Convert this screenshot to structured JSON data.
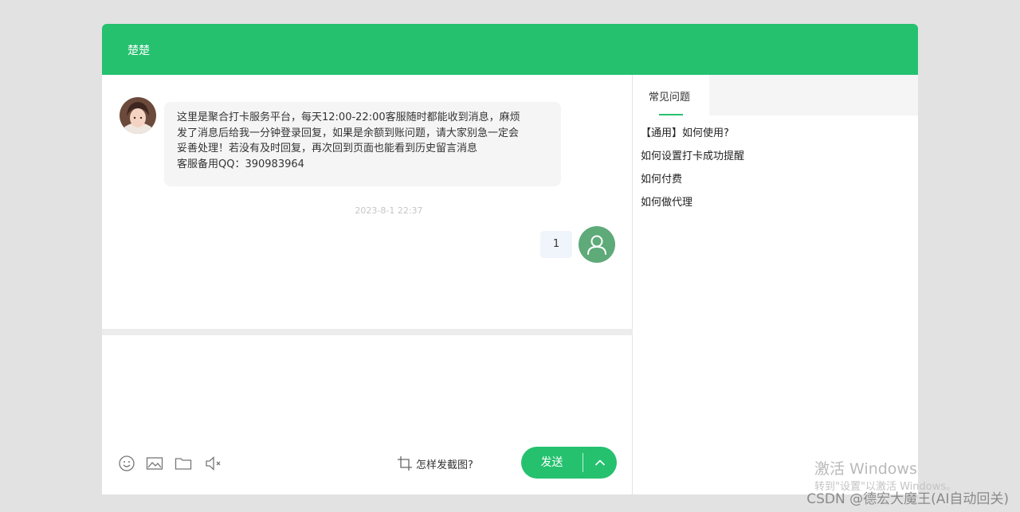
{
  "header": {
    "title": "楚楚"
  },
  "chat": {
    "welcome_lines": [
      "这里是聚合打卡服务平台，每天12:00-22:00客服随时都能收到消息，麻烦",
      "发了消息后给我一分钟登录回复，如果是余额到账问题，请大家别急一定会",
      "妥善处理！若没有及时回复，再次回到页面也能看到历史留言消息",
      "客服备用QQ：390983964"
    ],
    "timestamp": "2023-8-1 22:37",
    "user_message": "1"
  },
  "toolbar": {
    "icons": [
      "emoji-icon",
      "image-icon",
      "folder-icon",
      "sound-off-icon"
    ],
    "screenshot_tip": "怎样发截图?",
    "send_label": "发送"
  },
  "faq": {
    "tab_label": "常见问题",
    "items": [
      "【通用】如何使用?",
      "如何设置打卡成功提醒",
      "如何付费",
      "如何做代理"
    ]
  },
  "watermark": {
    "line1": "激活 Windows",
    "line2": "转到\"设置\"以激活 Windows。",
    "csdn": "CSDN @德宏大魔王(AI自动回关)"
  },
  "colors": {
    "brand_green": "#25c16f",
    "user_avatar": "#5eaa78"
  }
}
